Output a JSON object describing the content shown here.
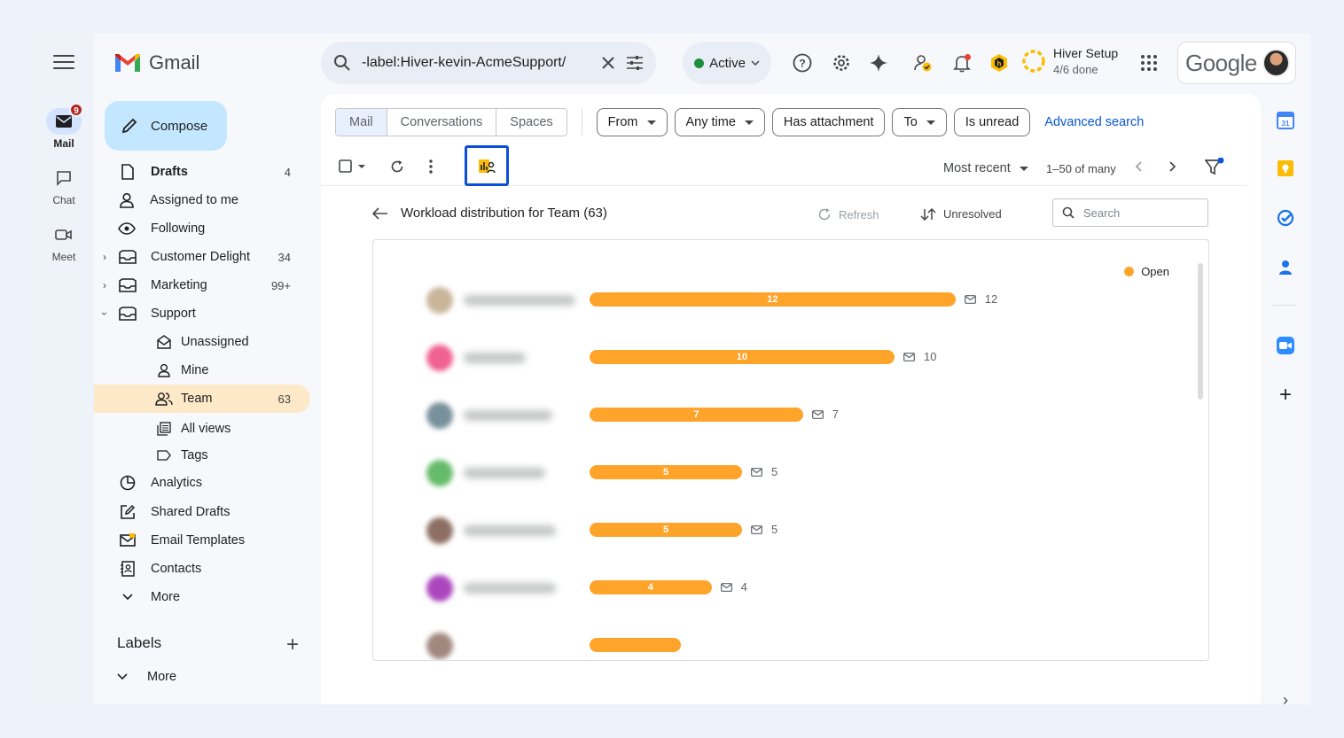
{
  "app": {
    "name": "Gmail"
  },
  "rail": {
    "mail": {
      "label": "Mail",
      "badge": "9"
    },
    "chat": {
      "label": "Chat"
    },
    "meet": {
      "label": "Meet"
    }
  },
  "header": {
    "search_query": "-label:Hiver-kevin-AcmeSupport/",
    "status": "Active",
    "setup_title": "Hiver Setup",
    "setup_progress": "4/6 done",
    "account_brand": "Google"
  },
  "compose_label": "Compose",
  "nav": {
    "drafts": {
      "label": "Drafts",
      "count": "4"
    },
    "assigned": {
      "label": "Assigned to me"
    },
    "following": {
      "label": "Following"
    },
    "customer_delight": {
      "label": "Customer Delight",
      "count": "34"
    },
    "marketing": {
      "label": "Marketing",
      "count": "99+"
    },
    "support": {
      "label": "Support"
    },
    "unassigned": {
      "label": "Unassigned"
    },
    "mine": {
      "label": "Mine"
    },
    "team": {
      "label": "Team",
      "count": "63"
    },
    "all_views": {
      "label": "All views"
    },
    "tags": {
      "label": "Tags"
    },
    "analytics": {
      "label": "Analytics"
    },
    "shared_drafts": {
      "label": "Shared Drafts"
    },
    "email_templates": {
      "label": "Email Templates"
    },
    "contacts": {
      "label": "Contacts"
    },
    "more": {
      "label": "More"
    }
  },
  "labels": {
    "title": "Labels",
    "more": "More"
  },
  "tabs": {
    "mail": "Mail",
    "conversations": "Conversations",
    "spaces": "Spaces"
  },
  "filters": {
    "from": "From",
    "any_time": "Any time",
    "has_attachment": "Has attachment",
    "to": "To",
    "is_unread": "Is unread",
    "advanced": "Advanced search"
  },
  "toolbar": {
    "sort": "Most recent",
    "pager": "1–50 of many"
  },
  "hiver": {
    "title": "Workload distribution for Team (63)",
    "refresh": "Refresh",
    "unresolved": "Unresolved",
    "search_placeholder": "Search"
  },
  "chart_data": {
    "type": "bar",
    "orientation": "horizontal",
    "series": [
      {
        "name": "Open",
        "values": [
          12,
          10,
          7,
          5,
          5,
          4
        ]
      }
    ],
    "categories_blurred": true,
    "legend": "top-right",
    "color": "#ffa42b"
  },
  "colors": {
    "accent": "#0b57d0",
    "bar": "#ffa42b",
    "selected_nav": "#fde9c7",
    "compose": "#c2e7ff"
  }
}
